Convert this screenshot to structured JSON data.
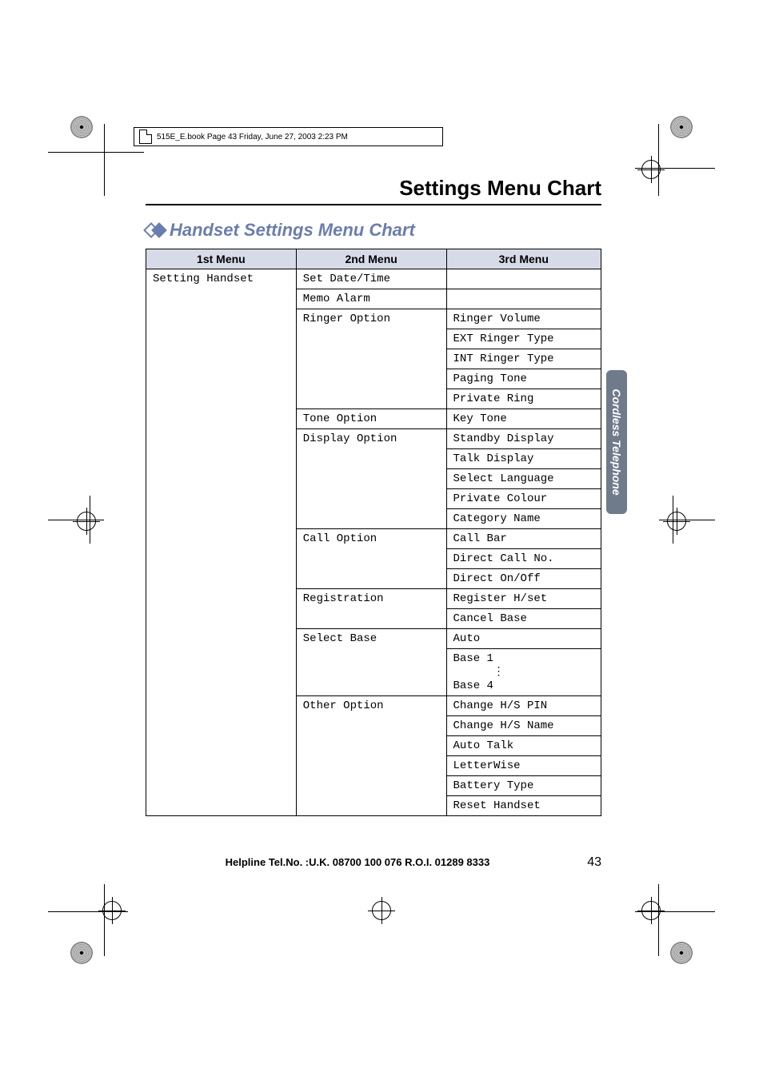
{
  "book_header": "515E_E.book  Page 43  Friday, June 27, 2003  2:23 PM",
  "page_title": "Settings Menu Chart",
  "section_title": "Handset Settings Menu Chart",
  "side_tab": "Cordless Telephone",
  "footer_help": "Helpline Tel.No. :U.K. 08700 100 076  R.O.I. 01289 8333",
  "page_number": "43",
  "table": {
    "headers": [
      "1st Menu",
      "2nd Menu",
      "3rd Menu"
    ],
    "col1_setting": "Setting Handset",
    "rows2": {
      "set_date_time": "Set Date/Time",
      "memo_alarm": "Memo Alarm",
      "ringer_option": "Ringer Option",
      "tone_option": "Tone Option",
      "display_option": "Display Option",
      "call_option": "Call Option",
      "registration": "Registration",
      "select_base": "Select Base",
      "other_option": "Other Option"
    },
    "rows3": {
      "ringer_volume": "Ringer Volume",
      "ext_ringer_type": "EXT Ringer Type",
      "int_ringer_type": "INT Ringer Type",
      "paging_tone": "Paging Tone",
      "private_ring": "Private Ring",
      "key_tone": "Key Tone",
      "standby_display": "Standby Display",
      "talk_display": "Talk Display",
      "select_language": "Select Language",
      "private_colour": "Private Colour",
      "category_name": "Category Name",
      "call_bar": "Call Bar",
      "direct_call_no": "Direct Call No.",
      "direct_on_off": "Direct On/Off",
      "register_hset": "Register H/set",
      "cancel_base": "Cancel Base",
      "auto": "Auto",
      "base1": "Base 1",
      "base4": "Base 4",
      "change_hs_pin": "Change H/S PIN",
      "change_hs_name": "Change H/S Name",
      "auto_talk": "Auto Talk",
      "letterwise": "LetterWise",
      "battery_type": "Battery Type",
      "reset_handset": "Reset Handset"
    }
  }
}
